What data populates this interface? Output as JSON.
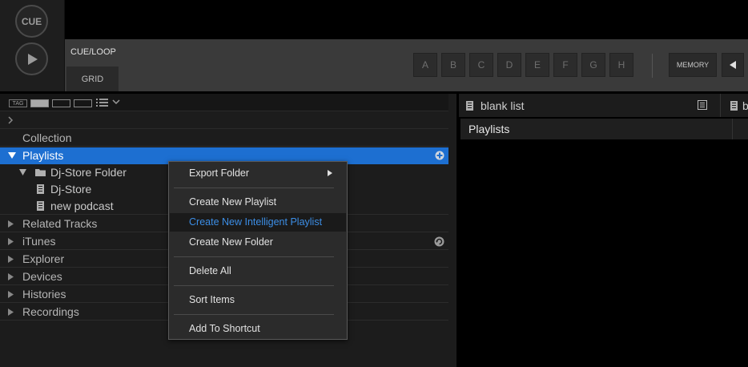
{
  "deck": {
    "cue_label": "CUE",
    "cueloop_label": "CUE/LOOP",
    "grid_label": "GRID",
    "hotcues": [
      "A",
      "B",
      "C",
      "D",
      "E",
      "F",
      "G",
      "H"
    ],
    "memory_label": "MEMORY"
  },
  "browser": {
    "tag_label": "TAG",
    "tree": {
      "collection": "Collection",
      "playlists": "Playlists",
      "dj_store_folder": "Dj-Store Folder",
      "dj_store": "Dj-Store",
      "new_podcast": "new podcast",
      "related_tracks": "Related Tracks",
      "itunes": "iTunes",
      "explorer": "Explorer",
      "devices": "Devices",
      "histories": "Histories",
      "recordings": "Recordings"
    },
    "selected_color": "#1d6fd1"
  },
  "context_menu": {
    "items": [
      "Export Folder",
      "Create New Playlist",
      "Create New Intelligent Playlist",
      "Create New Folder",
      "Delete All",
      "Sort Items",
      "Add To Shortcut"
    ],
    "highlighted_color": "#3c8ee6"
  },
  "right_panel": {
    "tab_title": "blank list",
    "next_tab_label": "b",
    "column_header": "Playlists"
  }
}
